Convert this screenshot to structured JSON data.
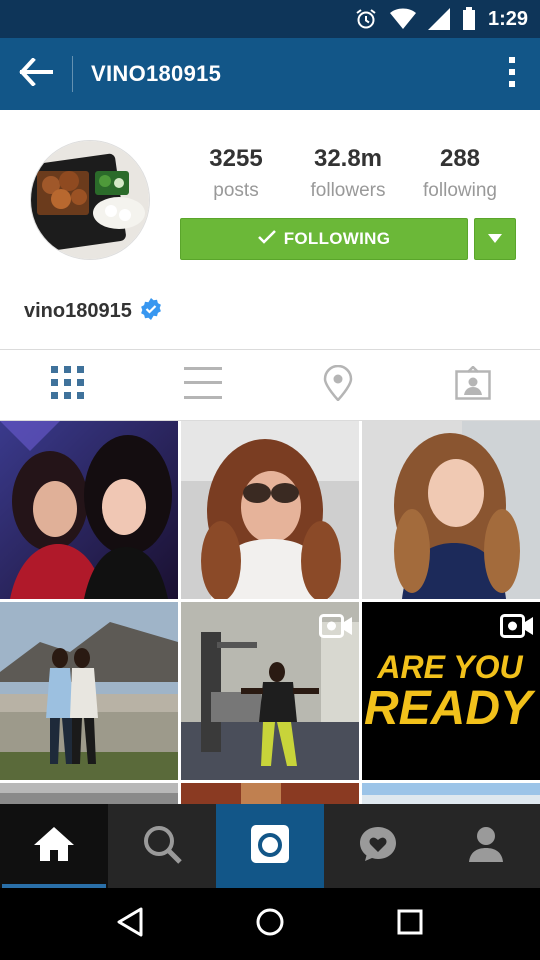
{
  "status_bar": {
    "time": "1:29",
    "icons": [
      "alarm-icon",
      "wifi-icon",
      "signal-icon",
      "battery-icon"
    ]
  },
  "header": {
    "title": "VINO180915",
    "back_icon": "back-arrow-icon",
    "menu_icon": "overflow-menu-icon"
  },
  "profile": {
    "username": "vino180915",
    "verified": true,
    "stats": [
      {
        "value": "3255",
        "label": "posts"
      },
      {
        "value": "32.8m",
        "label": "followers"
      },
      {
        "value": "288",
        "label": "following"
      }
    ],
    "follow_button_label": "FOLLOWING"
  },
  "tabs": [
    {
      "name": "grid-view",
      "icon": "grid-icon",
      "active": true
    },
    {
      "name": "list-view",
      "icon": "list-icon",
      "active": false
    },
    {
      "name": "map-view",
      "icon": "location-pin-icon",
      "active": false
    },
    {
      "name": "tagged-view",
      "icon": "tagged-person-icon",
      "active": false
    }
  ],
  "grid_posts": [
    {
      "type": "photo",
      "video": false
    },
    {
      "type": "photo",
      "video": false
    },
    {
      "type": "photo",
      "video": false
    },
    {
      "type": "photo",
      "video": false
    },
    {
      "type": "video",
      "video": true
    },
    {
      "type": "video",
      "video": true,
      "text_line1": "ARE YOU",
      "text_line2": "READY"
    }
  ],
  "bottom_nav": [
    {
      "name": "home",
      "icon": "home-icon",
      "active": true
    },
    {
      "name": "search",
      "icon": "search-icon",
      "active": false
    },
    {
      "name": "camera",
      "icon": "camera-icon",
      "active": false
    },
    {
      "name": "activity",
      "icon": "activity-heart-icon",
      "active": false
    },
    {
      "name": "profile",
      "icon": "profile-icon",
      "active": false
    }
  ],
  "colors": {
    "status_bar": "#0e3559",
    "header": "#125688",
    "follow_green": "#6bb838",
    "bottom_nav": "#262626",
    "verified_blue": "#3897f0"
  }
}
